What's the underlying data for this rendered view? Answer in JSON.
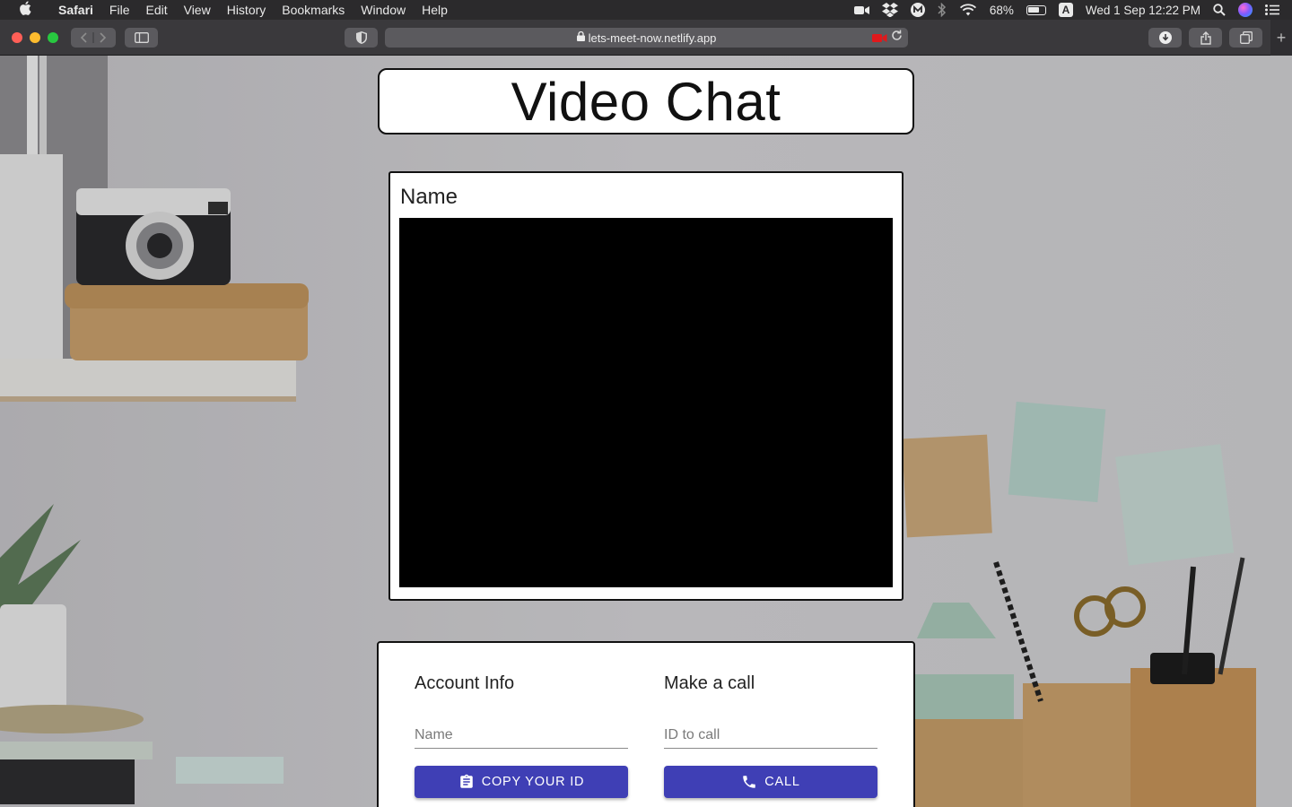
{
  "menubar": {
    "app": "Safari",
    "items": [
      "File",
      "Edit",
      "View",
      "History",
      "Bookmarks",
      "Window",
      "Help"
    ],
    "battery": "68%",
    "datetime": "Wed 1 Sep  12:22 PM",
    "input_source": "A"
  },
  "browser": {
    "url": "lets-meet-now.netlify.app"
  },
  "page": {
    "title": "Video Chat",
    "video_label": "Name",
    "account": {
      "heading": "Account Info",
      "placeholder": "Name",
      "button_label": "COPY YOUR ID"
    },
    "call": {
      "heading": "Make a call",
      "placeholder": "ID to call",
      "button_label": "CALL"
    }
  },
  "colors": {
    "primary_button": "#3f3fb5",
    "recording_indicator": "#e0191c"
  }
}
